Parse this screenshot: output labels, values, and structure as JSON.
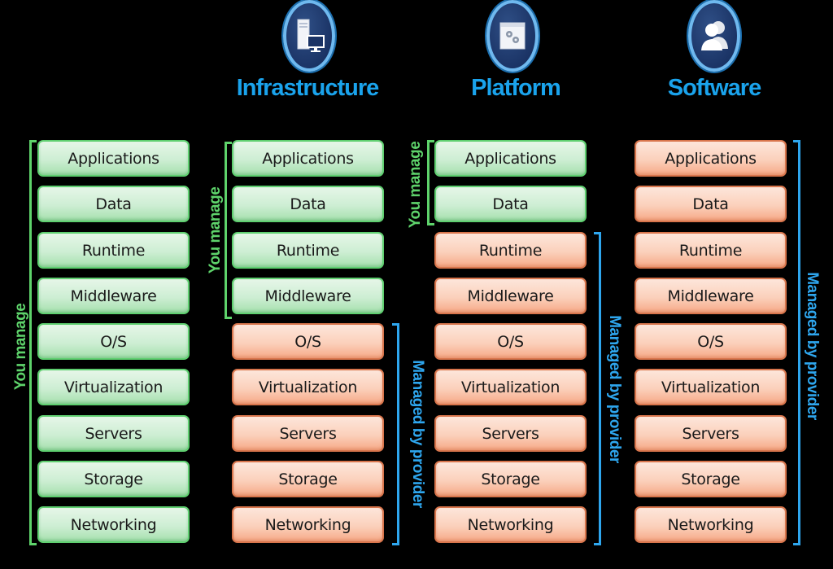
{
  "colors": {
    "background": "#000000",
    "you_manage": "#5ed36b",
    "managed_by_provider": "#2ea6ee",
    "heading": "#1aa3ec",
    "green_box": "#cdeed3",
    "orange_box": "#fbd0bb"
  },
  "labels": {
    "you_manage": "You manage",
    "managed_by_provider": "Managed by provider"
  },
  "columns": [
    {
      "id": "on-premises",
      "heading": "",
      "icon": "",
      "you_manage_count": 9,
      "layers": [
        "Applications",
        "Data",
        "Runtime",
        "Middleware",
        "O/S",
        "Virtualization",
        "Servers",
        "Storage",
        "Networking"
      ]
    },
    {
      "id": "infrastructure",
      "heading": "Infrastructure",
      "icon": "server-monitor-icon",
      "you_manage_count": 4,
      "layers": [
        "Applications",
        "Data",
        "Runtime",
        "Middleware",
        "O/S",
        "Virtualization",
        "Servers",
        "Storage",
        "Networking"
      ]
    },
    {
      "id": "platform",
      "heading": "Platform",
      "icon": "window-gears-icon",
      "you_manage_count": 2,
      "layers": [
        "Applications",
        "Data",
        "Runtime",
        "Middleware",
        "O/S",
        "Virtualization",
        "Servers",
        "Storage",
        "Networking"
      ]
    },
    {
      "id": "software",
      "heading": "Software",
      "icon": "users-icon",
      "you_manage_count": 0,
      "layers": [
        "Applications",
        "Data",
        "Runtime",
        "Middleware",
        "O/S",
        "Virtualization",
        "Servers",
        "Storage",
        "Networking"
      ]
    }
  ]
}
